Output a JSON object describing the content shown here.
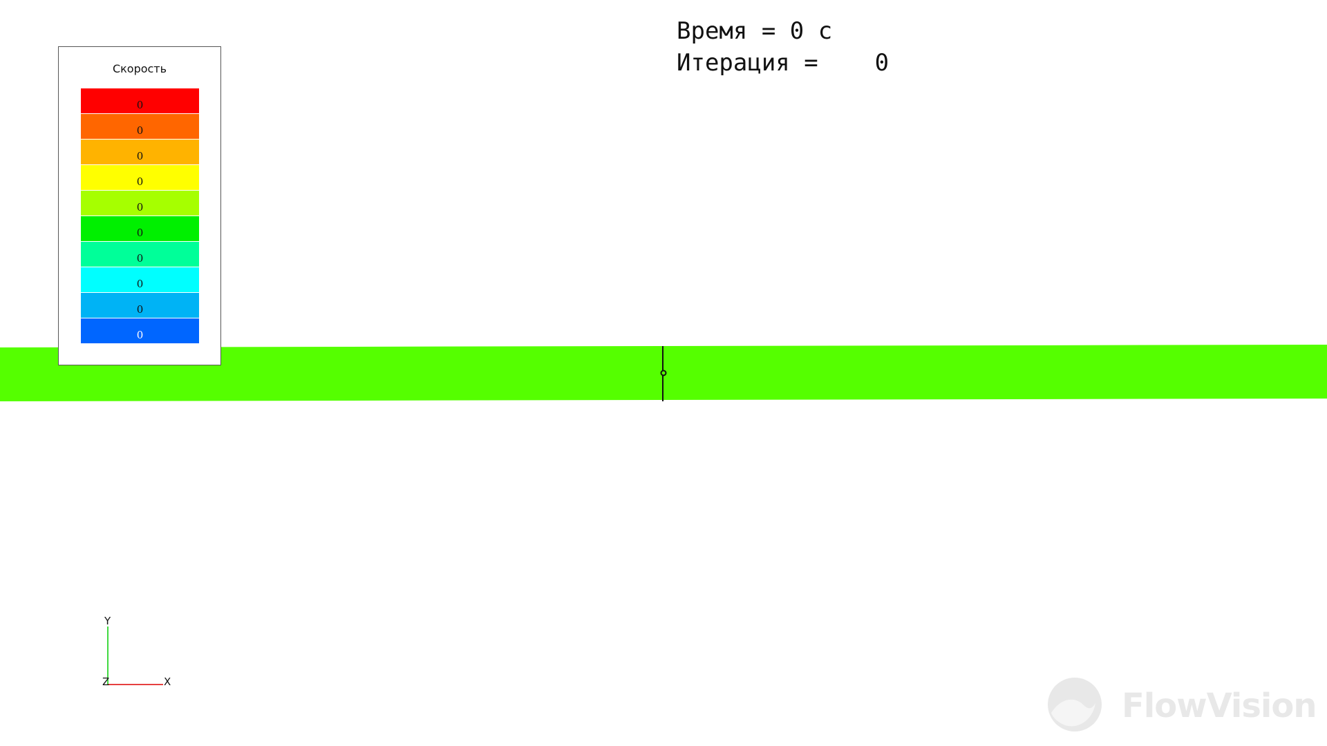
{
  "legend": {
    "title": "Скорость",
    "swatches": [
      {
        "label": "0",
        "color": "#ff0000",
        "text_color": "#111111"
      },
      {
        "label": "0",
        "color": "#ff6600",
        "text_color": "#111111"
      },
      {
        "label": "0",
        "color": "#ffb300",
        "text_color": "#111111"
      },
      {
        "label": "0",
        "color": "#ffff00",
        "text_color": "#111111"
      },
      {
        "label": "0",
        "color": "#a6ff00",
        "text_color": "#111111"
      },
      {
        "label": "0",
        "color": "#00f000",
        "text_color": "#111111"
      },
      {
        "label": "0",
        "color": "#00ff99",
        "text_color": "#111111"
      },
      {
        "label": "0",
        "color": "#00ffff",
        "text_color": "#111111"
      },
      {
        "label": "0",
        "color": "#00b3f5",
        "text_color": "#111111"
      },
      {
        "label": "0",
        "color": "#0066ff",
        "text_color": "#ffffff"
      }
    ]
  },
  "info": {
    "time_line": "Время = 0 с",
    "iteration_line": "Итерация =    0"
  },
  "flow": {
    "color": "#55ff00"
  },
  "axes": {
    "x_label": "X",
    "y_label": "Y",
    "z_label": "Z",
    "x_color": "#dd0000",
    "y_color": "#00cc00"
  },
  "watermark": {
    "text": "FlowVision"
  }
}
